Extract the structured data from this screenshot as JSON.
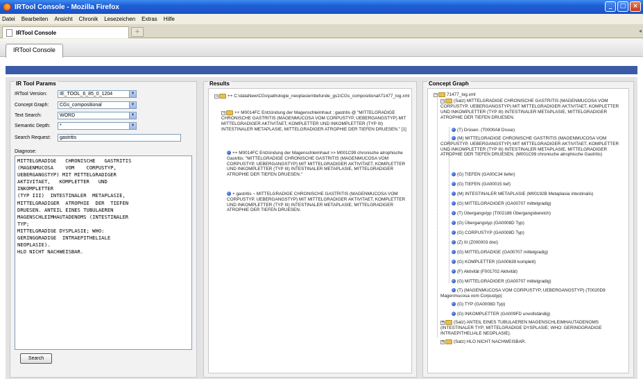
{
  "window": {
    "title": "IRTool Console - Mozilla Firefox"
  },
  "menu": [
    "Datei",
    "Bearbeiten",
    "Ansicht",
    "Chronik",
    "Lesezeichen",
    "Extras",
    "Hilfe"
  ],
  "browser_tab": {
    "label": "IRTool Console"
  },
  "app": {
    "tab_label": "IRTool Console"
  },
  "params": {
    "title": "IR Tool Params",
    "version": {
      "label": "IRTool Version:",
      "value": "IE_TOOL_6_85_0_1204"
    },
    "graph": {
      "label": "Concept Graph:",
      "value": "CGs_compositional"
    },
    "textsearch": {
      "label": "Text Search:",
      "value": "WORD"
    },
    "depth": {
      "label": "Semantic Depth:",
      "value": "*"
    },
    "request": {
      "label": "Search Request:",
      "value": "gastritis"
    },
    "diagnose_label": "Diagnose:",
    "diagnose_text": "MITTELGRADIGE   CHRONISCHE   GASTRITIS\n(MAGENMUCOSA    VOM    CORPUSTYP,\nUEBERGANGSTYP) MIT MITTELGRADIGER\nAKTIVITAET,   KOMPLETTER   UND\nINKOMPLETTER\n(TYP III)  INTESTINALER  METAPLASIE,\nMITTELGRADIGER  ATROPHIE  DER  TIEFEN\nDRUESEN. ANTEIL EINES TUBULAEREN\nMAGENSCHLEIMHAUTADENOMS (INTESTINALER\nTYP;\nMITTELGRADIGE DYSPLASIE; WHO:\nGERINGGRADIGE  INTRAEPITHELIALE\nNEOPLASIE).\nHLO NICHT NACHWEISBAR.",
    "search_button": "Search"
  },
  "results": {
    "title": "Results",
    "root": "++ C:\\dataNew\\CGs\\pathologie_neoplasien\\befunde_gs1\\CGs_compositional\\71477_log.xml",
    "n1": "++ M0014FC Entzündung der Magenschleimhaut ; gastritis @ \"MITTELGRADIGE CHRONISCHE GASTRITIS (MAGENMUCOSA VOM CORPUSTYP, UEBERGANGSTYP) MIT MITTELGRADIGER AKTIVITAET, KOMPLETTER UND INKOMPLETTER (TYP III) INTESTINALER METAPLASIE, MITTELGRADIGER ATROPHIE DER TIEFEN DRUESEN.\" [1]",
    "n2": "++ M0014FC Entzündung der Magenschleimhaut >> M001C99 chronische atrophische Gastritis: \"MITTELGRADIGE CHRONISCHE GASTRITIS (MAGENMUCOSA VOM CORPUSTYP, UEBERGANGSTYP) MIT MITTELGRADIGER AKTIVITAET, KOMPLETTER UND INKOMPLETTER (TYP III) INTESTINALER METAPLASIE, MITTELGRADIGER ATROPHIE DER TIEFEN DRUESEN.\"",
    "n3": "+ gastritis ~ MITTELGRADIGE CHRONISCHE GASTRITIS (MAGENMUCOSA VOM CORPUSTYP, UEBERGANGSTYP) MIT MITTELGRADIGER AKTIVITAET, KOMPLETTER UND INKOMPLETTER (TYP III) INTESTINALER METAPLASIE, MITTELGRADIGER ATROPHIE DER TIEFEN DRUESEN."
  },
  "graph": {
    "title": "Concept Graph",
    "root": "71477_log.xml",
    "satz1": "(Satz) MITTELGRADIGE CHRONISCHE GASTRITIS (MAGENMUCOSA VOM CORPUSTYP, UEBERGANGSTYP) MIT MITTELGRADIGER AKTIVITAET, KOMPLETTER UND INKOMPLETTER (TYP III) INTESTINALER METAPLASIE, MITTELGRADIGER ATROPHIE DER TIEFEN DRUESEN.",
    "t_druesen": "(T) Drüsen. (T0000A8 Druse)",
    "m_node": "(M) MITTELGRADIGE CHRONISCHE GASTRITIS (MAGENMUCOSA VOM CORPUSTYP, UEBERGANGSTYP) MIT MITTELGRADIGER AKTIVITAET, KOMPLETTER UND INKOMPLETTER (TYP III) INTESTINALER METAPLASIE, MITTELGRADIGER ATROPHIE DER TIEFEN DRUESEN. (M001C99 chronische atrophische Gastritis)",
    "leaves": [
      "(G) TIEFEN (GA00C34 tiefer)",
      "(G) TIEFEN (GA00015 tief)",
      "(M) INTESTINALER METAPLASIE (M00192B Metaplasia intestinalis)",
      "(G) MITTELGRADIGER (GA00707 mittelgradig)",
      "(T) Übergangstyp (T002188 Übergangsbereich)",
      "(G) Übergangstyp (GA0008D Typ)",
      "(G) CORPUSTYP (GA0008D Typ)",
      "(Z) III (Z000003 drei)",
      "(G) MITTELGRADIGE (GA00707 mittelgradig)",
      "(G) KOMPLETTER (GA00639 komplett)",
      "(F) Aktivität (F001702 Aktivität)",
      "(G) MITTELGRADIGER (GA00707 mittelgradig)"
    ],
    "t_magen": "(T) (MAGENMUCOSA VOM CORPUSTYP, UEBERGANGSTYP) (T0020D9 Magenmucosa vom Corpustyp)",
    "leaves2": [
      "(G) TYP (GA0008D Typ)",
      "(G) INKOMPLETTER (GA009FD unvollständig)"
    ],
    "satz2": "(Satz) ANTEIL EINES TUBULAEREN MAGENSCHLEIMHAUTADENOMS (INTESTINALER TYP; MITTELGRADIGE DYSPLASIE; WHO: GERINGGRADIGE INTRAEPITHELIALE NEOPLASIE).",
    "satz3": "(Satz) HLO NICHT NACHWEISBAR."
  }
}
